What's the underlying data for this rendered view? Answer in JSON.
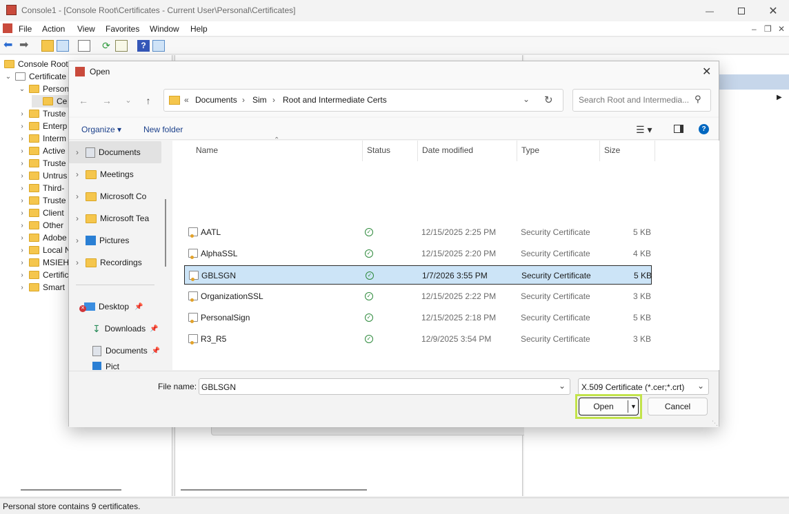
{
  "app": {
    "title": "Console1 - [Console Root\\Certificates - Current User\\Personal\\Certificates]",
    "menu": [
      "File",
      "Action",
      "View",
      "Favorites",
      "Window",
      "Help"
    ],
    "tree": [
      {
        "label": "Console Root"
      },
      {
        "label": "Certificate"
      },
      {
        "label": "Person"
      },
      {
        "label": "Ce"
      },
      {
        "label": "Truste"
      },
      {
        "label": "Enterp"
      },
      {
        "label": "Interm"
      },
      {
        "label": "Active"
      },
      {
        "label": "Truste"
      },
      {
        "label": "Untrus"
      },
      {
        "label": "Third-"
      },
      {
        "label": "Truste"
      },
      {
        "label": "Client"
      },
      {
        "label": "Other"
      },
      {
        "label": "Adobe"
      },
      {
        "label": "Local N"
      },
      {
        "label": "MSIEH"
      },
      {
        "label": "Certific"
      },
      {
        "label": "Smart"
      }
    ],
    "status": "Personal store contains 9 certificates."
  },
  "dialog": {
    "title": "Open",
    "breadcrumb": [
      "«",
      "Documents",
      "Sim",
      "Root and Intermediate Certs"
    ],
    "search_placeholder": "Search Root and Intermedia...",
    "organize": "Organize",
    "new_folder": "New folder",
    "nav": [
      {
        "label": "Documents",
        "selected": true
      },
      {
        "label": "Meetings"
      },
      {
        "label": "Microsoft Co"
      },
      {
        "label": "Microsoft Tea"
      },
      {
        "label": "Pictures"
      },
      {
        "label": "Recordings"
      }
    ],
    "quick": [
      {
        "label": "Desktop"
      },
      {
        "label": "Downloads"
      },
      {
        "label": "Documents"
      },
      {
        "label": "Pict"
      }
    ],
    "columns": [
      "Name",
      "Status",
      "Date modified",
      "Type",
      "Size"
    ],
    "files": [
      {
        "name": "AATL",
        "date": "12/15/2025 2:25 PM",
        "type": "Security Certificate",
        "size": "5 KB"
      },
      {
        "name": "AlphaSSL",
        "date": "12/15/2025 2:20 PM",
        "type": "Security Certificate",
        "size": "4 KB"
      },
      {
        "name": "GBLSGN",
        "date": "1/7/2026 3:55 PM",
        "type": "Security Certificate",
        "size": "5 KB",
        "selected": true
      },
      {
        "name": "OrganizationSSL",
        "date": "12/15/2025 2:22 PM",
        "type": "Security Certificate",
        "size": "3 KB"
      },
      {
        "name": "PersonalSign",
        "date": "12/15/2025 2:18 PM",
        "type": "Security Certificate",
        "size": "5 KB"
      },
      {
        "name": "R3_R5",
        "date": "12/9/2025 3:54 PM",
        "type": "Security Certificate",
        "size": "3 KB"
      }
    ],
    "filename_label": "File name:",
    "filename_value": "GBLSGN",
    "filetype": "X.509 Certificate (*.cer;*.crt)",
    "open_label": "Open",
    "cancel_label": "Cancel",
    "colors": {
      "accent": "#0067c0",
      "highlight": "#c2e34a",
      "selection": "#cce4f7"
    }
  }
}
